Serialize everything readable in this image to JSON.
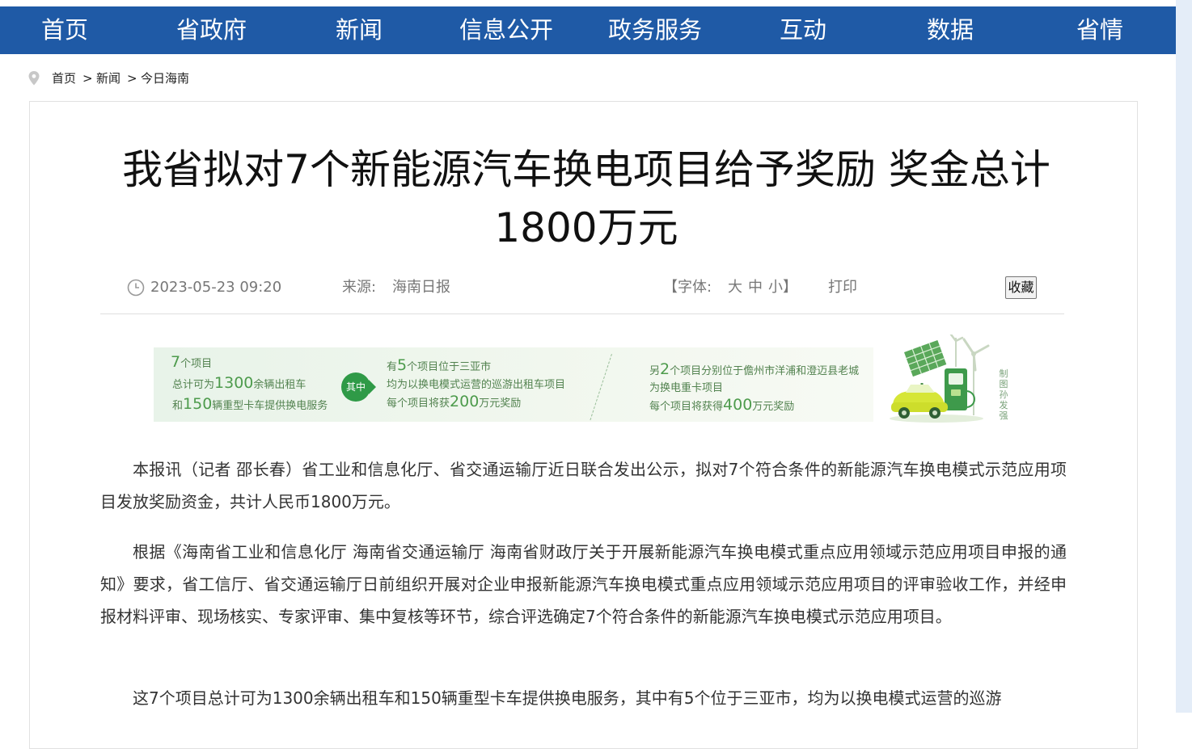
{
  "nav": [
    "首页",
    "省政府",
    "新闻",
    "信息公开",
    "政务服务",
    "互动",
    "数据",
    "省情"
  ],
  "breadcrumb": {
    "home": "首页",
    "sep": ">",
    "news": "新闻",
    "current": "今日海南"
  },
  "article": {
    "title_line1": "我省拟对7个新能源汽车换电项目给予奖励  奖金总计",
    "title_line2": "1800万元",
    "meta": {
      "datetime": "2023-05-23 09:20",
      "source_label": "来源:",
      "source": "海南日报",
      "font_open": "【字体:",
      "font_large": "大",
      "font_medium": "中",
      "font_small": "小",
      "font_close": "】",
      "print": "打印",
      "favorite": "收藏"
    },
    "banner": {
      "b1_num": "7",
      "b1_l1": "个项目",
      "b1_l2a": "总计可为",
      "b1_num2": "1300",
      "b1_l2b": "余辆出租车",
      "b1_l3a": "和",
      "b1_num3": "150",
      "b1_l3b": "辆重型卡车提供换电服务",
      "badge": "其中",
      "b2_l1a": "有",
      "b2_num": "5",
      "b2_l1b": "个项目位于三亚市",
      "b2_l2": "均为以换电模式运营的巡游出租车项目",
      "b2_l3a": "每个项目将获",
      "b2_num2": "200",
      "b2_l3b": "万元奖励",
      "b3_l1a": "另",
      "b3_num": "2",
      "b3_l1b": "个项目分别位于儋州市洋浦和澄迈县老城",
      "b3_l2": "为换电重卡项目",
      "b3_l3a": "每个项目将获得",
      "b3_num2": "400",
      "b3_l3b": "万元奖励",
      "side_label": "制图 孙发强"
    },
    "paragraphs": [
      "本报讯（记者  邵长春）省工业和信息化厅、省交通运输厅近日联合发出公示，拟对7个符合条件的新能源汽车换电模式示范应用项目发放奖励资金，共计人民币1800万元。",
      "根据《海南省工业和信息化厅  海南省交通运输厅  海南省财政厅关于开展新能源汽车换电模式重点应用领域示范应用项目申报的通知》要求，省工信厅、省交通运输厅日前组织开展对企业申报新能源汽车换电模式重点应用领域示范应用项目的评审验收工作，并经申报材料评审、现场核实、专家评审、集中复核等环节，综合评选确定7个符合条件的新能源汽车换电模式示范应用项目。",
      "这7个项目总计可为1300余辆出租车和150辆重型卡车提供换电服务，其中有5个位于三亚市，均为以换电模式运营的巡游"
    ]
  },
  "colors": {
    "nav_bg": "#1f5aa6",
    "banner_green": "#4d9b4c"
  }
}
